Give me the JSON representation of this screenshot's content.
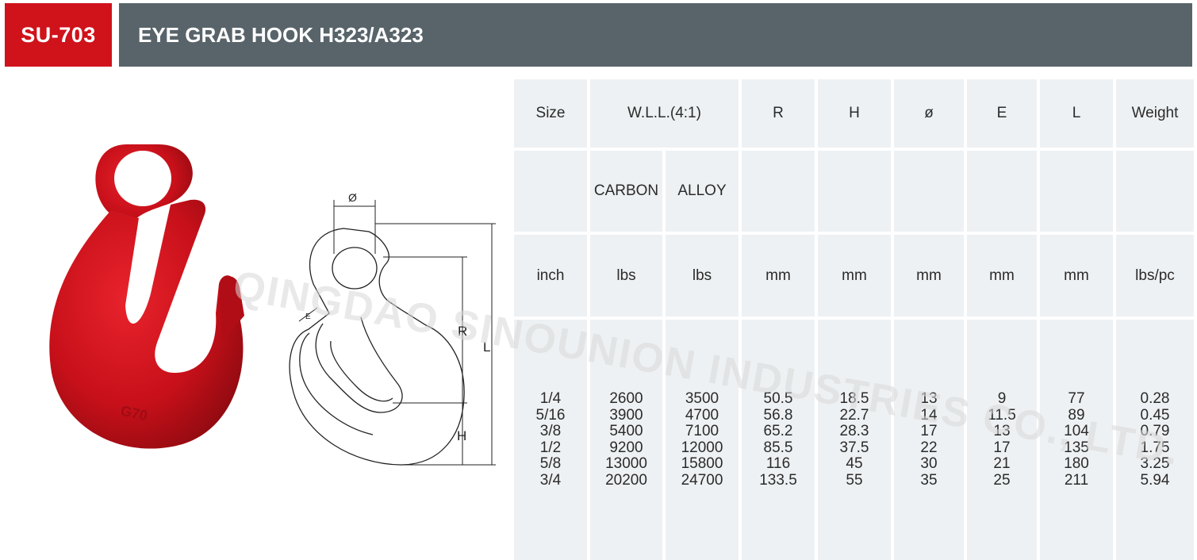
{
  "header": {
    "code": "SU-703",
    "title": "EYE GRAB HOOK H323/A323"
  },
  "watermark": "QINGDAO SINOUNION INDUSTRIES CO., LTD.",
  "drawing_labels": {
    "diameter": "Ø",
    "e": "E",
    "r": "R",
    "l": "L",
    "h": "H"
  },
  "photo_marking": "G70",
  "colors": {
    "brand_red": "#d0121b",
    "header_gray": "#58646a",
    "cell_bg": "#eef1f3",
    "hook_red": "#c8101a"
  },
  "table": {
    "headers": {
      "size": "Size",
      "wll": "W.L.L.(4:1)",
      "r": "R",
      "h": "H",
      "dia": "ø",
      "e": "E",
      "l": "L",
      "weight": "Weight"
    },
    "sub": {
      "carbon": "CARBON",
      "alloy": "ALLOY"
    },
    "units": [
      "inch",
      "lbs",
      "lbs",
      "mm",
      "mm",
      "mm",
      "mm",
      "mm",
      "lbs/pc"
    ],
    "columns": [
      [
        "1/4",
        "5/16",
        "3/8",
        "1/2",
        "5/8",
        "3/4"
      ],
      [
        "2600",
        "3900",
        "5400",
        "9200",
        "13000",
        "20200"
      ],
      [
        "3500",
        "4700",
        "7100",
        "12000",
        "15800",
        "24700"
      ],
      [
        "50.5",
        "56.8",
        "65.2",
        "85.5",
        "116",
        "133.5"
      ],
      [
        "18.5",
        "22.7",
        "28.3",
        "37.5",
        "45",
        "55"
      ],
      [
        "13",
        "14",
        "17",
        "22",
        "30",
        "35"
      ],
      [
        "9",
        "11.5",
        "13",
        "17",
        "21",
        "25"
      ],
      [
        "77",
        "89",
        "104",
        "135",
        "180",
        "211"
      ],
      [
        "0.28",
        "0.45",
        "0.79",
        "1.75",
        "3.25",
        "5.94"
      ]
    ]
  }
}
